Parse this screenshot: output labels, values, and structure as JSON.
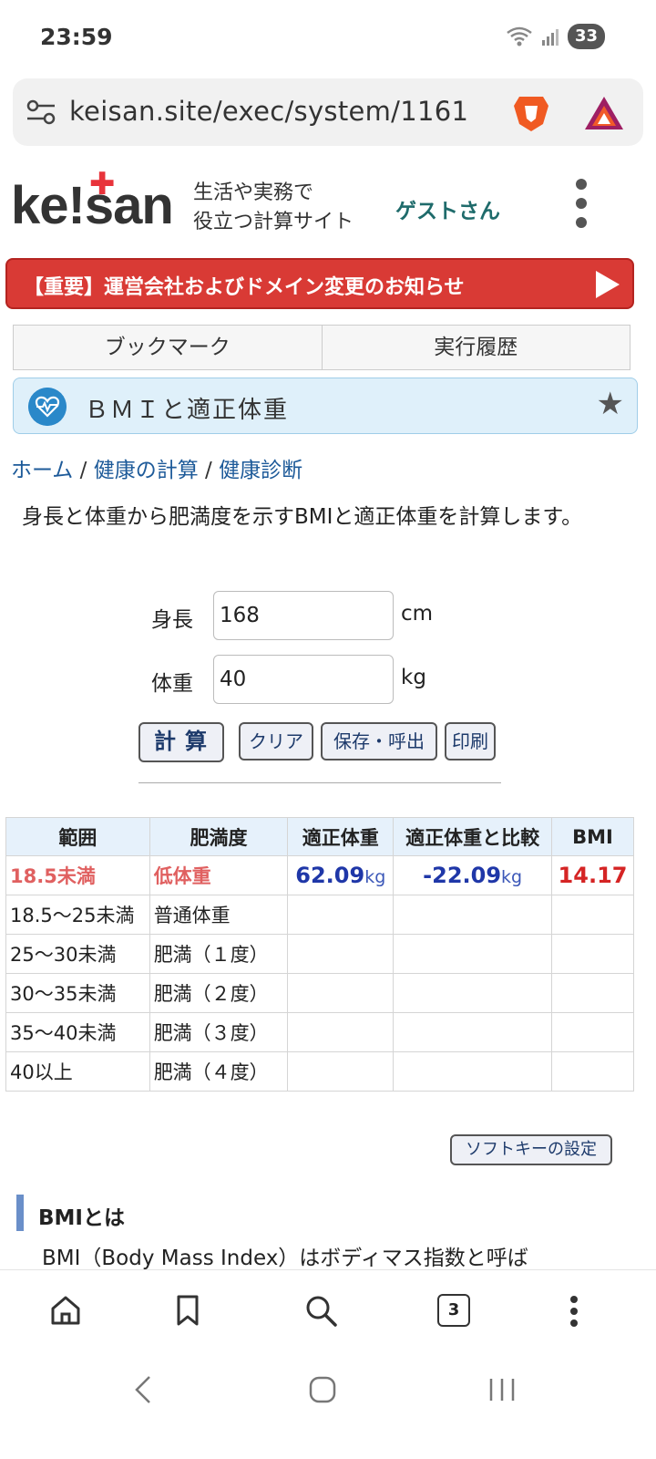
{
  "status": {
    "time": "23:59",
    "battery": "33"
  },
  "browser": {
    "url": "keisan.site/exec/system/1161",
    "tabs_count": "3"
  },
  "header": {
    "logo_text": "ke!san",
    "tagline_1": "生活や実務で",
    "tagline_2": "役立つ計算サイト",
    "user": "ゲストさん"
  },
  "notice": {
    "text": "【重要】運営会社およびドメイン変更のお知らせ"
  },
  "tabs": {
    "bookmark": "ブックマーク",
    "history": "実行履歴"
  },
  "page": {
    "title": "ＢＭＩと適正体重",
    "breadcrumb": [
      "ホーム",
      "健康の計算",
      "健康診断"
    ],
    "description": "身長と体重から肥満度を示すBMIと適正体重を計算します。"
  },
  "form": {
    "height_label": "身長",
    "height_value": "168",
    "height_unit": "cm",
    "weight_label": "体重",
    "weight_value": "40",
    "weight_unit": "kg",
    "calc_button": "計算",
    "clear_button": "クリア",
    "save_button": "保存・呼出",
    "print_button": "印刷"
  },
  "table": {
    "headers": [
      "範囲",
      "肥満度",
      "適正体重",
      "適正体重と比較",
      "BMI"
    ],
    "rows": [
      {
        "range": "18.5未満",
        "category": "低体重"
      },
      {
        "range": "18.5〜25未満",
        "category": "普通体重"
      },
      {
        "range": "25〜30未満",
        "category": "肥満（１度）"
      },
      {
        "range": "30〜35未満",
        "category": "肥満（２度）"
      },
      {
        "range": "35〜40未満",
        "category": "肥満（３度）"
      },
      {
        "range": "40以上",
        "category": "肥満（４度）"
      }
    ],
    "result": {
      "ideal_weight": "62.09",
      "ideal_unit": "kg",
      "diff": "-22.09",
      "diff_unit": "kg",
      "bmi": "14.17"
    }
  },
  "softkey_button": "ソフトキーの設定",
  "section": {
    "heading": "BMIとは",
    "text": "BMI（Body Mass Index）はボディマス指数と呼ば"
  },
  "colors": {
    "accent_red": "#d93a35",
    "link_blue": "#1d5a99",
    "bmi_red": "#d52424"
  }
}
